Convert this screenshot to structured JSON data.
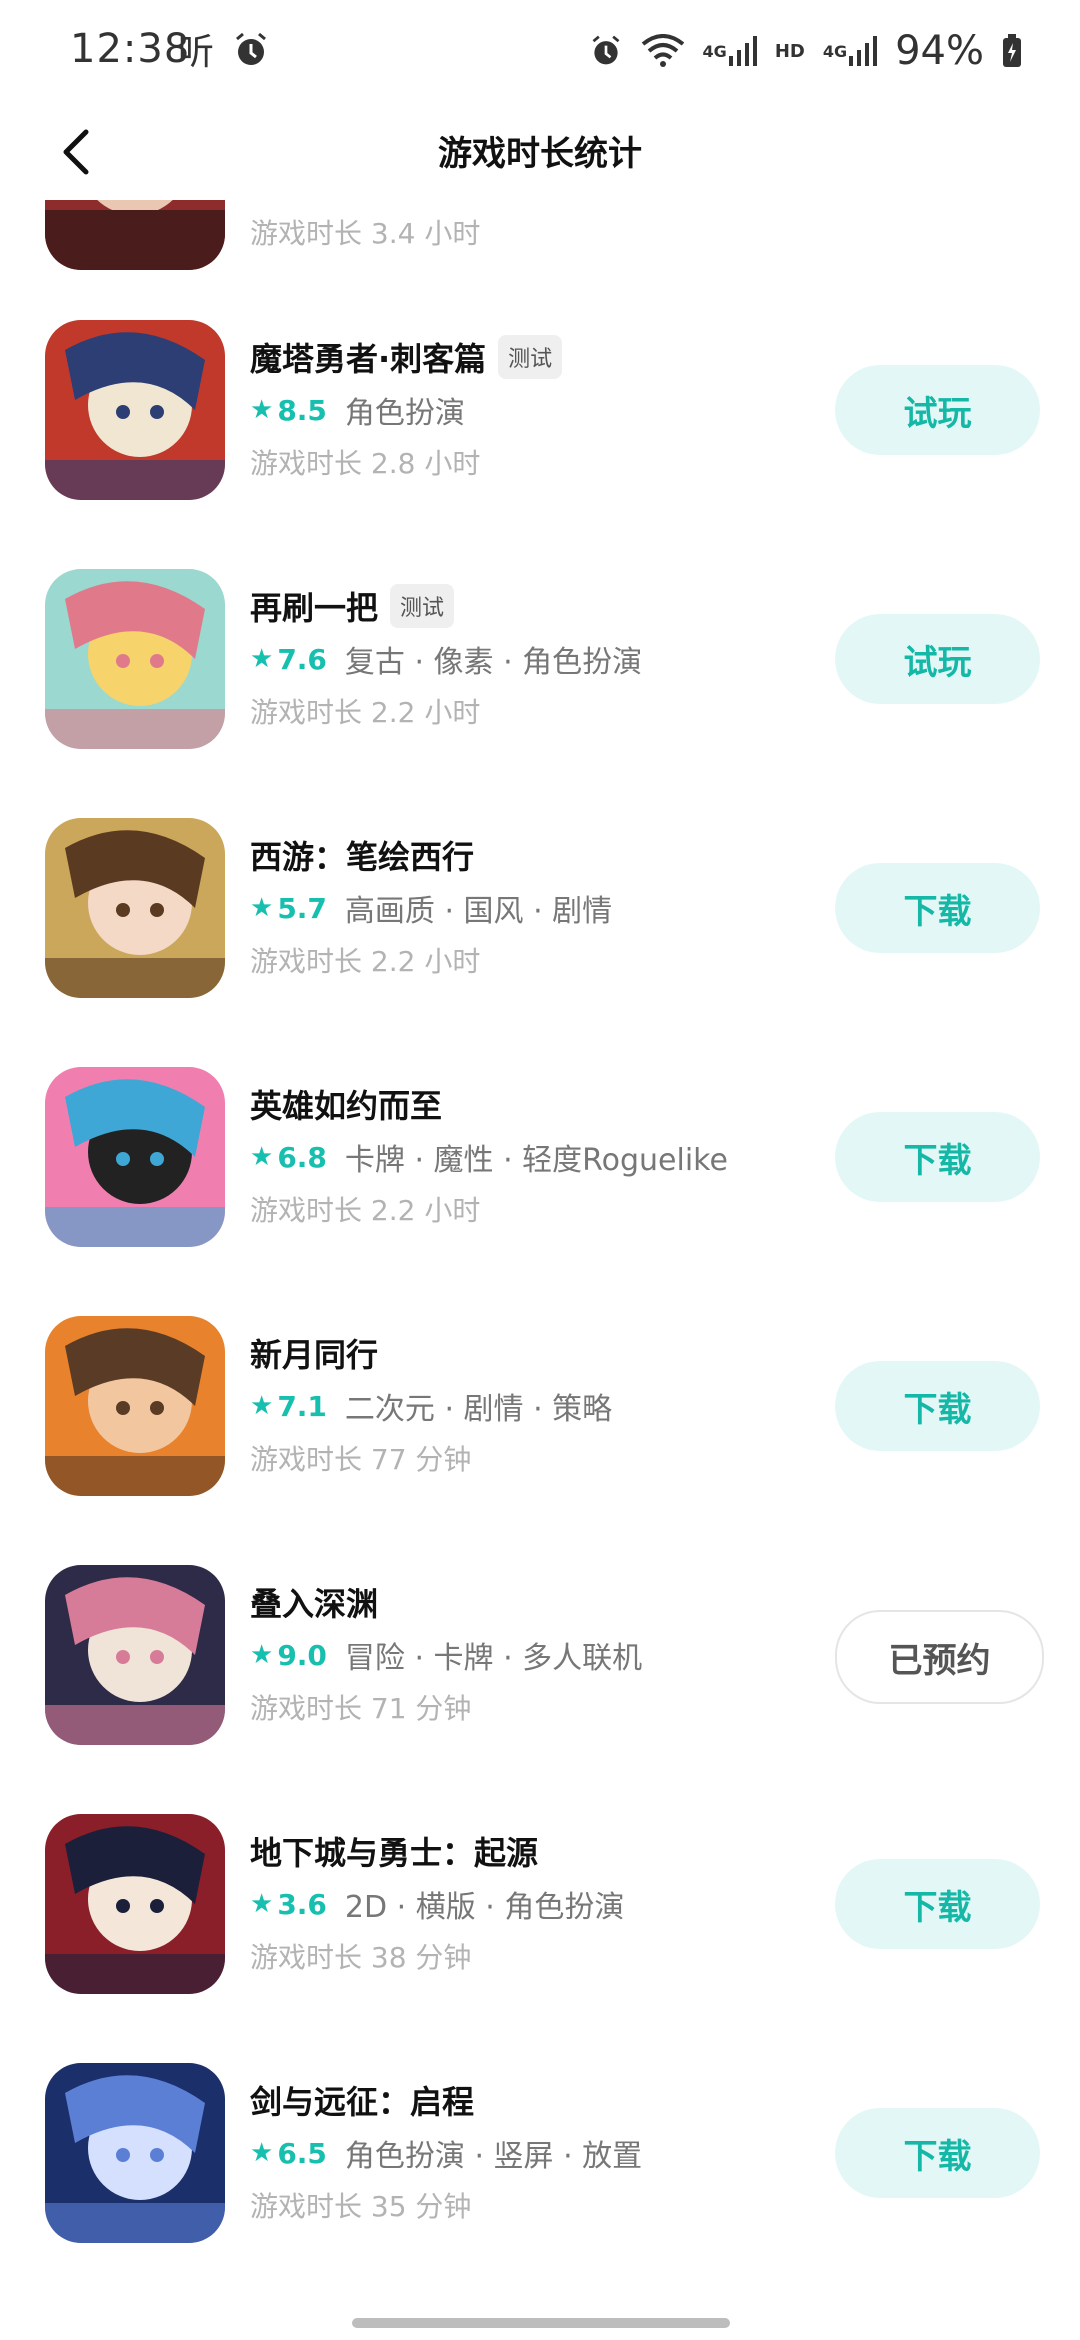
{
  "status_bar": {
    "time": "12:38",
    "network_4g_1": "4G",
    "hd_label": "HD",
    "network_4g_2": "4G",
    "battery": "94%",
    "icons": [
      "music-app-icon",
      "alarm-icon",
      "alarm-icon",
      "wifi-icon",
      "signal-icon",
      "battery-icon"
    ]
  },
  "header": {
    "title": "游戏时长统计",
    "back_icon": "chevron-left-icon"
  },
  "partial_row": {
    "playtime": "游戏时长 3.4 小时"
  },
  "games": [
    {
      "title": "魔塔勇者·刺客篇",
      "tag": "测试",
      "rating": "8.5",
      "tags": "角色扮演",
      "playtime": "游戏时长 2.8 小时",
      "action": "试玩",
      "colors": [
        "#c0392b",
        "#2c3e73",
        "#f0e6d2"
      ]
    },
    {
      "title": "再刷一把",
      "tag": "测试",
      "rating": "7.6",
      "tags": "复古 · 像素 · 角色扮演",
      "playtime": "游戏时长 2.2 小时",
      "action": "试玩",
      "colors": [
        "#9ad8d0",
        "#e07a8a",
        "#f6d36b"
      ]
    },
    {
      "title": "西游：笔绘西行",
      "tag": "",
      "rating": "5.7",
      "tags": "高画质 · 国风 · 剧情",
      "playtime": "游戏时长 2.2 小时",
      "action": "下载",
      "colors": [
        "#caa75a",
        "#5b3a22",
        "#f3d9c6"
      ]
    },
    {
      "title": "英雄如约而至",
      "tag": "",
      "rating": "6.8",
      "tags": "卡牌 · 魔性 · 轻度Roguelike",
      "playtime": "游戏时长 2.2 小时",
      "action": "下载",
      "colors": [
        "#f07fb0",
        "#3fa7d6",
        "#222222"
      ]
    },
    {
      "title": "新月同行",
      "tag": "",
      "rating": "7.1",
      "tags": "二次元 · 剧情 · 策略",
      "playtime": "游戏时长 77 分钟",
      "action": "下载",
      "colors": [
        "#e8822c",
        "#5a3b25",
        "#f2c7a0"
      ]
    },
    {
      "title": "叠入深渊",
      "tag": "",
      "rating": "9.0",
      "tags": "冒险 · 卡牌 · 多人联机",
      "playtime": "游戏时长 71 分钟",
      "action": "已预约",
      "colors": [
        "#2d2b48",
        "#d77c98",
        "#f0e4d8"
      ]
    },
    {
      "title": "地下城与勇士：起源",
      "tag": "",
      "rating": "3.6",
      "tags": "2D · 横版 · 角色扮演",
      "playtime": "游戏时长 38 分钟",
      "action": "下载",
      "colors": [
        "#8a1f2a",
        "#1c1f3a",
        "#f4e7da"
      ]
    },
    {
      "title": "剑与远征：启程",
      "tag": "",
      "rating": "6.5",
      "tags": "角色扮演 · 竖屏 · 放置",
      "playtime": "游戏时长 35 分钟",
      "action": "下载",
      "colors": [
        "#1b2f6b",
        "#5c7fd6",
        "#d5e0ff"
      ]
    }
  ],
  "theme": {
    "accent": "#17bfae",
    "button_bg": "#e3f8f6"
  }
}
